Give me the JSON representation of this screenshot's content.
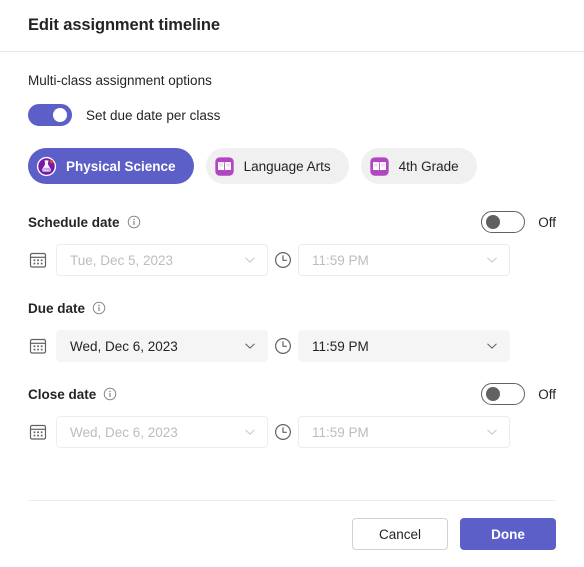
{
  "header": {
    "title": "Edit assignment timeline"
  },
  "multi_class": {
    "section_label": "Multi-class assignment options",
    "toggle": {
      "state": "on",
      "label": "Set due date per class"
    }
  },
  "class_chips": [
    {
      "label": "Physical Science",
      "icon": "flask-icon",
      "selected": true
    },
    {
      "label": "Language Arts",
      "icon": "book-icon",
      "selected": false
    },
    {
      "label": "4th Grade",
      "icon": "book-icon",
      "selected": false
    }
  ],
  "date_groups": [
    {
      "key": "schedule",
      "title": "Schedule date",
      "info_icon": "info-icon",
      "toggle": {
        "state": "off",
        "state_label": "Off",
        "visible": true
      },
      "enabled": false,
      "date": {
        "icon": "calendar-icon",
        "value": "Tue, Dec 5, 2023",
        "chevron": "chevron-down-icon"
      },
      "time": {
        "icon": "clock-icon",
        "value": "11:59 PM",
        "chevron": "chevron-down-icon"
      }
    },
    {
      "key": "due",
      "title": "Due date",
      "info_icon": "info-icon",
      "toggle": {
        "state": "",
        "state_label": "",
        "visible": false
      },
      "enabled": true,
      "date": {
        "icon": "calendar-icon",
        "value": "Wed, Dec 6, 2023",
        "chevron": "chevron-down-icon"
      },
      "time": {
        "icon": "clock-icon",
        "value": "11:59 PM",
        "chevron": "chevron-down-icon"
      }
    },
    {
      "key": "close",
      "title": "Close date",
      "info_icon": "info-icon",
      "toggle": {
        "state": "off",
        "state_label": "Off",
        "visible": true
      },
      "enabled": false,
      "date": {
        "icon": "calendar-icon",
        "value": "Wed, Dec 6, 2023",
        "chevron": "chevron-down-icon"
      },
      "time": {
        "icon": "clock-icon",
        "value": "11:59 PM",
        "chevron": "chevron-down-icon"
      }
    }
  ],
  "footer": {
    "cancel_label": "Cancel",
    "done_label": "Done"
  },
  "colors": {
    "accent": "#5b5fc7",
    "field_fill": "#f5f5f5",
    "chip_fill": "#f0f0f0",
    "text": "#242424",
    "disabled_text": "#bdbdbd",
    "divider": "#ededed"
  }
}
